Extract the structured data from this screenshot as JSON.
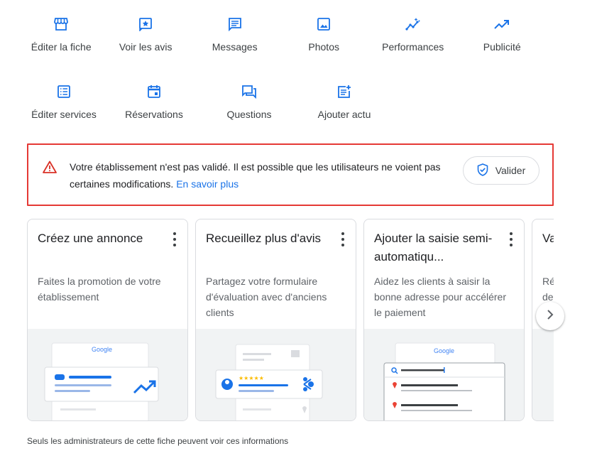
{
  "actions": {
    "row1": [
      {
        "label": "Éditer la fiche",
        "icon": "storefront-icon"
      },
      {
        "label": "Voir les avis",
        "icon": "star-review-icon"
      },
      {
        "label": "Messages",
        "icon": "message-icon"
      },
      {
        "label": "Photos",
        "icon": "photo-icon"
      },
      {
        "label": "Performances",
        "icon": "insights-icon"
      },
      {
        "label": "Publicité",
        "icon": "trending-up-icon"
      }
    ],
    "row2": [
      {
        "label": "Éditer services",
        "icon": "list-icon"
      },
      {
        "label": "Réservations",
        "icon": "calendar-icon"
      },
      {
        "label": "Questions",
        "icon": "question-answer-icon"
      },
      {
        "label": "Ajouter actu",
        "icon": "post-add-icon"
      }
    ]
  },
  "alert": {
    "text": "Votre établissement n'est pas validé. Il est possible que les utilisateurs ne voient pas certaines modifications.",
    "link": "En savoir plus",
    "button": "Valider"
  },
  "cards": [
    {
      "title": "Créez une annonce",
      "desc": "Faites la promotion de votre établissement"
    },
    {
      "title": "Recueillez plus d'avis",
      "desc": "Partagez votre formulaire d'évaluation avec d'anciens clients"
    },
    {
      "title": "Ajouter la saisie semi-automatiqu...",
      "desc": "Aidez les clients à saisir la bonne adresse pour accélérer le paiement"
    },
    {
      "title": "Va",
      "desc": "Ré de"
    }
  ],
  "illustration": {
    "brand": "Google",
    "stars": "★★★★★"
  },
  "footer": "Seuls les administrateurs de cette fiche peuvent voir ces informations",
  "colors": {
    "accent": "#1a73e8",
    "alert_border": "#e53935",
    "pin": "#ea4335"
  }
}
